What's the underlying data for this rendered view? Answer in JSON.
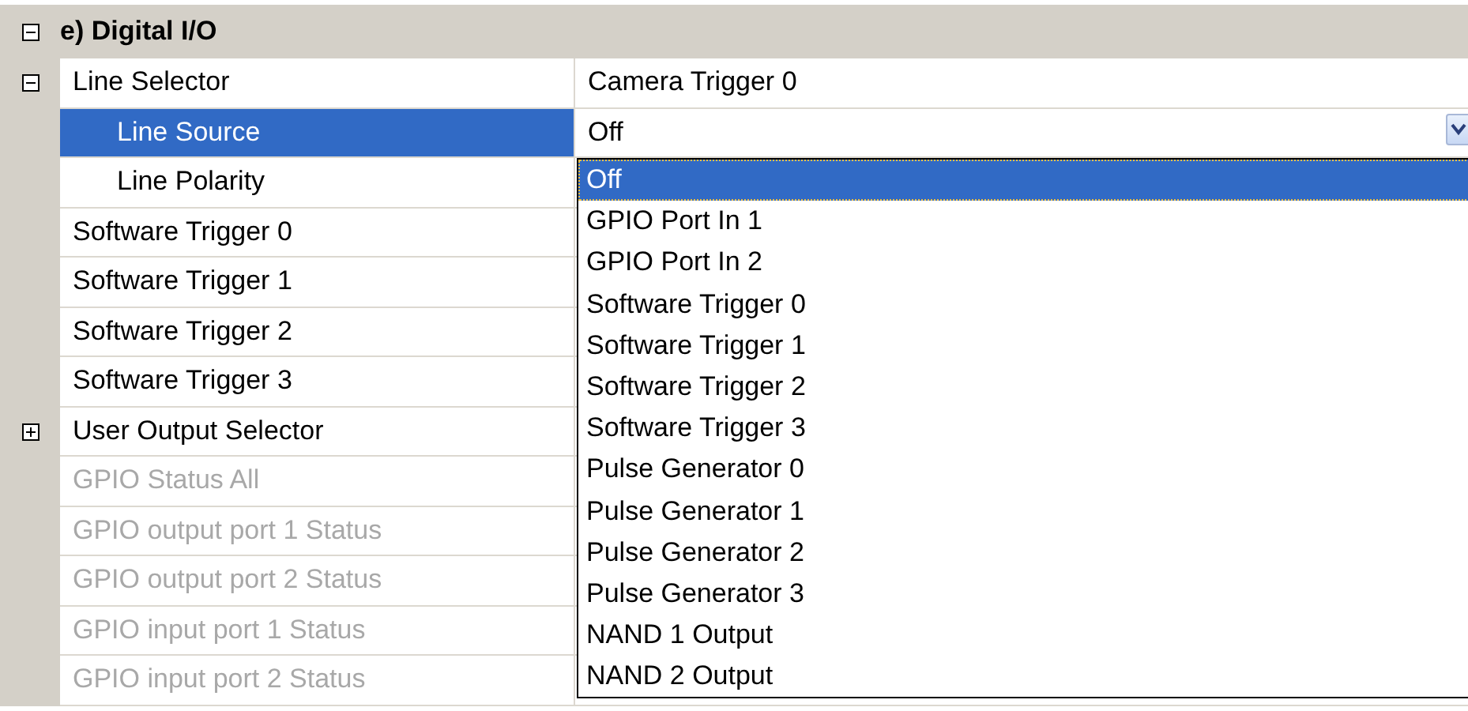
{
  "category": {
    "label": "e) Digital I/O",
    "expanded": true
  },
  "rows": [
    {
      "name": "Line Selector",
      "value": "Camera Trigger 0",
      "expanded": true,
      "selected": false,
      "disabled": false,
      "children": [
        {
          "name": "Line Source",
          "value": "Off",
          "selected": true,
          "disabled": false
        },
        {
          "name": "Line Polarity",
          "selected": false,
          "disabled": false
        }
      ]
    },
    {
      "name": "Software Trigger 0",
      "selected": false,
      "disabled": false
    },
    {
      "name": "Software Trigger 1",
      "selected": false,
      "disabled": false
    },
    {
      "name": "Software Trigger 2",
      "selected": false,
      "disabled": false
    },
    {
      "name": "Software Trigger 3",
      "selected": false,
      "disabled": false
    },
    {
      "name": "User Output Selector",
      "expanded": false,
      "selected": false,
      "disabled": false
    },
    {
      "name": "GPIO Status All",
      "selected": false,
      "disabled": true
    },
    {
      "name": "GPIO output port 1 Status",
      "selected": false,
      "disabled": true
    },
    {
      "name": "GPIO output port 2 Status",
      "selected": false,
      "disabled": true
    },
    {
      "name": "GPIO input port 1 Status",
      "selected": false,
      "disabled": true
    },
    {
      "name": "GPIO input port 2 Status",
      "selected": false,
      "disabled": true
    }
  ],
  "dropdown": {
    "options": [
      {
        "label": "Off",
        "selected": true
      },
      {
        "label": "GPIO Port In 1",
        "selected": false
      },
      {
        "label": "GPIO Port In 2",
        "selected": false
      },
      {
        "label": "Software Trigger 0",
        "selected": false
      },
      {
        "label": "Software Trigger 1",
        "selected": false
      },
      {
        "label": "Software Trigger 2",
        "selected": false
      },
      {
        "label": "Software Trigger 3",
        "selected": false
      },
      {
        "label": "Pulse Generator 0",
        "selected": false
      },
      {
        "label": "Pulse Generator 1",
        "selected": false
      },
      {
        "label": "Pulse Generator 2",
        "selected": false
      },
      {
        "label": "Pulse Generator 3",
        "selected": false
      },
      {
        "label": "NAND 1 Output",
        "selected": false
      },
      {
        "label": "NAND 2 Output",
        "selected": false
      }
    ]
  }
}
